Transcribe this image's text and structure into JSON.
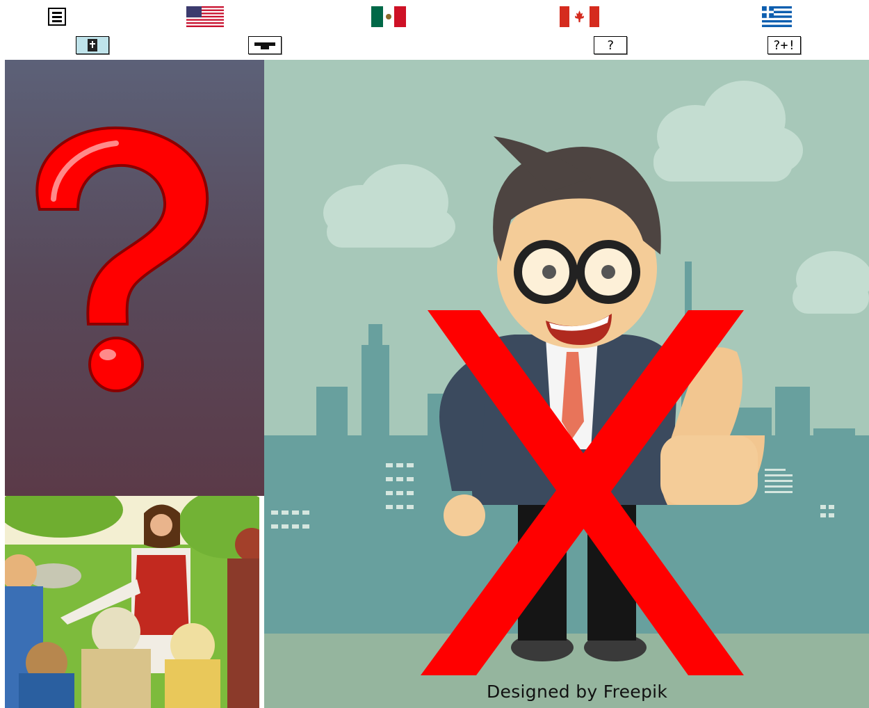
{
  "toolbar": {
    "menu_icon": "hamburger-menu-icon",
    "flags": [
      {
        "name": "usa-flag-icon"
      },
      {
        "name": "mexico-flag-icon"
      },
      {
        "name": "canada-flag-icon"
      },
      {
        "name": "greece-flag-icon"
      }
    ],
    "buttons": [
      {
        "name": "bible-button",
        "icon": "bible-icon"
      },
      {
        "name": "graduation-cap-button",
        "icon": "graduation-cap-icon"
      },
      {
        "name": "question-button",
        "label": "?"
      },
      {
        "name": "question-exclaim-button",
        "label": "?+!"
      }
    ]
  },
  "colors": {
    "question_mark": "#ff0000",
    "cross_mark": "#ff0000",
    "sky": "#a6c6b8",
    "city": "#6a9c9a",
    "suit": "#3b4a5e"
  },
  "main_image": {
    "credit": "Designed by Freepik",
    "description_icon": "businessman-thumbs-up-crossed-out"
  },
  "left_image": {
    "icon": "red-question-mark-icon"
  },
  "bottom_image": {
    "icon": "jesus-with-disciples-illustration"
  }
}
